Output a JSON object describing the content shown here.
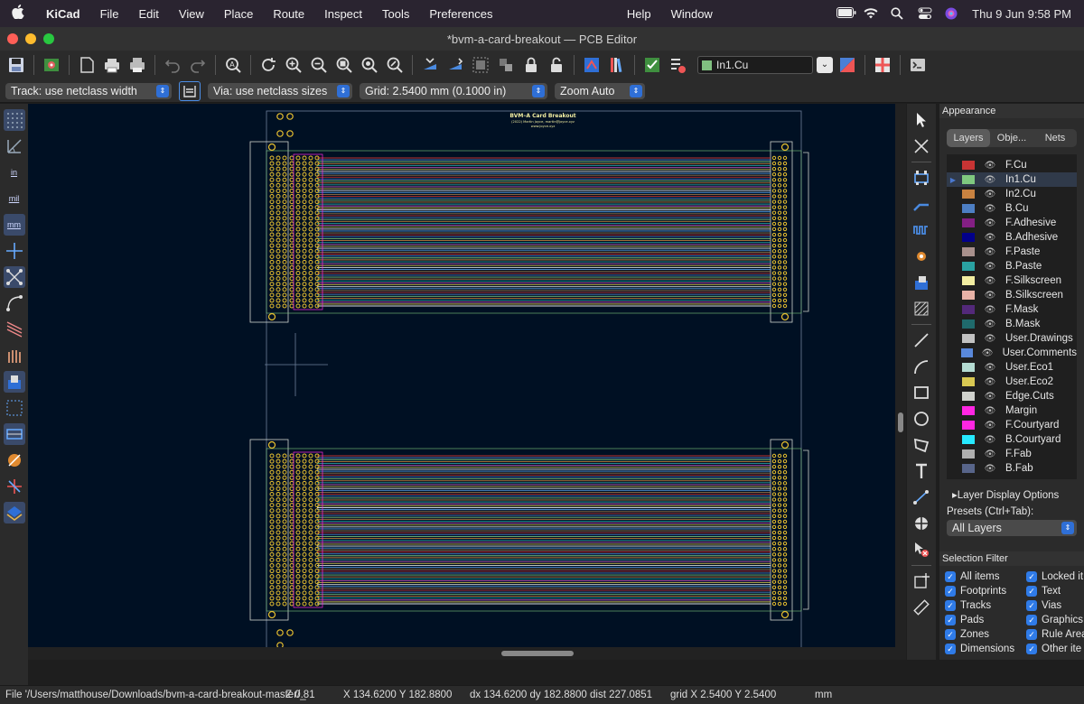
{
  "menubar": {
    "apple": "",
    "items": [
      "KiCad",
      "File",
      "Edit",
      "View",
      "Place",
      "Route",
      "Inspect",
      "Tools",
      "Preferences",
      "Help",
      "Window"
    ],
    "clock": "Thu 9 Jun  9:58 PM"
  },
  "window": {
    "title": "*bvm-a-card-breakout — PCB Editor"
  },
  "toolbar": {
    "active_layer": "In1.Cu",
    "active_layer_color": "#80c080"
  },
  "toolbar2": {
    "track": "Track: use netclass width",
    "via": "Via: use netclass sizes",
    "grid": "Grid: 2.5400 mm (0.1000 in)",
    "zoom": "Zoom Auto"
  },
  "left_toolbar": {
    "inch": "in",
    "mil": "mil",
    "mm": "mm"
  },
  "board": {
    "title": "BVM–A Card Breakout",
    "subtitle": "(2022) Martin Joyce, martin@joyce.xyz",
    "url": "www.joyce.xyz"
  },
  "appearance": {
    "title": "Appearance",
    "tabs": [
      "Layers",
      "Obje...",
      "Nets"
    ],
    "layers": [
      {
        "name": "F.Cu",
        "color": "#c83434"
      },
      {
        "name": "In1.Cu",
        "color": "#7fc87f",
        "current": true
      },
      {
        "name": "In2.Cu",
        "color": "#c88240"
      },
      {
        "name": "B.Cu",
        "color": "#4d7fc4"
      },
      {
        "name": "F.Adhesive",
        "color": "#841f84"
      },
      {
        "name": "B.Adhesive",
        "color": "#02008a"
      },
      {
        "name": "F.Paste",
        "color": "#a8908c"
      },
      {
        "name": "B.Paste",
        "color": "#2aa2a2"
      },
      {
        "name": "F.Silkscreen",
        "color": "#f2eda1"
      },
      {
        "name": "B.Silkscreen",
        "color": "#e8b2a7"
      },
      {
        "name": "F.Mask",
        "color": "#53297a"
      },
      {
        "name": "B.Mask",
        "color": "#1f6a6c"
      },
      {
        "name": "User.Drawings",
        "color": "#c2c2c2"
      },
      {
        "name": "User.Comments",
        "color": "#5988da"
      },
      {
        "name": "User.Eco1",
        "color": "#b4dbd2"
      },
      {
        "name": "User.Eco2",
        "color": "#d8c852"
      },
      {
        "name": "Edge.Cuts",
        "color": "#d0d2cd"
      },
      {
        "name": "Margin",
        "color": "#ff26e2"
      },
      {
        "name": "F.Courtyard",
        "color": "#ff26e2"
      },
      {
        "name": "B.Courtyard",
        "color": "#26e9ff"
      },
      {
        "name": "F.Fab",
        "color": "#afafaf"
      },
      {
        "name": "B.Fab",
        "color": "#58658a"
      }
    ],
    "display_options": "Layer Display Options",
    "presets_label": "Presets (Ctrl+Tab):",
    "presets_value": "All Layers"
  },
  "selection_filter": {
    "title": "Selection Filter",
    "items": [
      "All items",
      "Locked it",
      "Footprints",
      "Text",
      "Tracks",
      "Vias",
      "Pads",
      "Graphics",
      "Zones",
      "Rule Area",
      "Dimensions",
      "Other ite"
    ]
  },
  "status": {
    "file": "File '/Users/matthouse/Downloads/bvm-a-card-breakout-master/_",
    "zoom": "Z 0.81",
    "xy": "X 134.6200  Y 182.8800",
    "delta": "dx 134.6200  dy 182.8800  dist 227.0851",
    "grid": "grid X 2.5400  Y 2.5400",
    "units": "mm"
  }
}
